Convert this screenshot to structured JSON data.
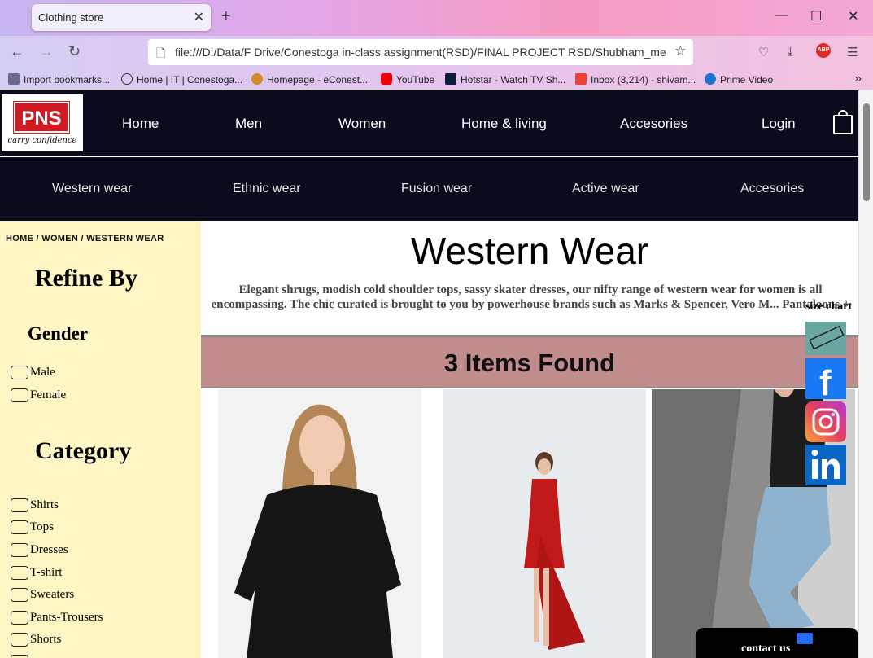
{
  "browser": {
    "tab_title": "Clothing store",
    "url": "file:///D:/Data/F Drive/Conestoga in-class assignment(RSD)/FINAL PROJECT RSD/Shubham_mevada",
    "bookmarks": [
      "Import bookmarks...",
      "Home | IT | Conestoga...",
      "Homepage - eConest...",
      "YouTube",
      "Hotstar - Watch TV Sh...",
      "Inbox (3,214) - shivam...",
      "Prime Video"
    ]
  },
  "site": {
    "logo_text": "PNS",
    "logo_tagline": "carry confidence",
    "nav": [
      "Home",
      "Men",
      "Women",
      "Home & living",
      "Accesories",
      "Login"
    ],
    "subnav": [
      "Western wear",
      "Ethnic wear",
      "Fusion wear",
      "Active wear",
      "Accesories"
    ]
  },
  "sidebar": {
    "breadcrumb": "HOME  /  WOMEN  /  WESTERN  WEAR",
    "refine_title": "Refine By",
    "gender_title": "Gender",
    "gender_options": [
      "Male",
      "Female"
    ],
    "category_title": "Category",
    "category_options": [
      "Shirts",
      "Tops",
      "Dresses",
      "T-shirt",
      "Sweaters",
      "Pants-Trousers",
      "Shorts"
    ]
  },
  "main": {
    "title": "Western Wear",
    "description": "Elegant shrugs, modish cold shoulder tops, sassy skater dresses, our nifty range of western wear for women is all encompassing. The chic curated is brought to you by powerhouse brands such as Marks & Spencer, Vero M... Pantaloons.+",
    "items_found": "3 Items Found"
  },
  "side_panel": {
    "size_chart_label": "size chart",
    "contact_label": "contact us"
  },
  "colors": {
    "nav_bg": "#0b0b1e",
    "sidebar_bg": "#fdf6c4",
    "found_bar_bg": "#c08c8c",
    "logo_red": "#d21a22",
    "facebook": "#1877f2",
    "linkedin": "#0a66c2"
  }
}
